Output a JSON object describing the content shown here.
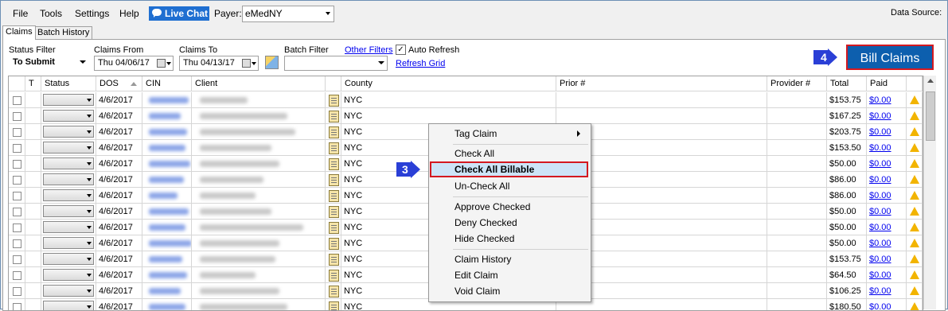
{
  "menu": {
    "file": "File",
    "tools": "Tools",
    "settings": "Settings",
    "help": "Help",
    "live_chat": "Live Chat",
    "payer_label": "Payer:",
    "payer_value": "eMedNY",
    "data_source_label": "Data Source:"
  },
  "tabs": {
    "claims": "Claims",
    "batch_history": "Batch History"
  },
  "filters": {
    "status_filter_label": "Status Filter",
    "status_filter_value": "To Submit",
    "claims_from_label": "Claims From",
    "claims_from_value": "Thu 04/06/17",
    "claims_to_label": "Claims To",
    "claims_to_value": "Thu 04/13/17",
    "batch_filter_label": "Batch Filter",
    "other_filters": "Other Filters",
    "auto_refresh": "Auto Refresh",
    "refresh_grid": "Refresh Grid"
  },
  "bill_claims": "Bill Claims",
  "callouts": {
    "step3": "3",
    "step4": "4"
  },
  "columns": {
    "t": "T",
    "status": "Status",
    "dos": "DOS",
    "cin": "CIN",
    "client": "Client",
    "county": "County",
    "prior": "Prior #",
    "provider": "Provider #",
    "total": "Total",
    "paid": "Paid"
  },
  "rows": [
    {
      "dos": "4/6/2017",
      "county": "NYC",
      "total": "$153.75",
      "paid": "$0.00"
    },
    {
      "dos": "4/6/2017",
      "county": "NYC",
      "total": "$167.25",
      "paid": "$0.00"
    },
    {
      "dos": "4/6/2017",
      "county": "NYC",
      "total": "$203.75",
      "paid": "$0.00"
    },
    {
      "dos": "4/6/2017",
      "county": "NYC",
      "total": "$153.50",
      "paid": "$0.00"
    },
    {
      "dos": "4/6/2017",
      "county": "NYC",
      "total": "$50.00",
      "paid": "$0.00"
    },
    {
      "dos": "4/6/2017",
      "county": "NYC",
      "total": "$86.00",
      "paid": "$0.00"
    },
    {
      "dos": "4/6/2017",
      "county": "NYC",
      "total": "$86.00",
      "paid": "$0.00"
    },
    {
      "dos": "4/6/2017",
      "county": "NYC",
      "total": "$50.00",
      "paid": "$0.00"
    },
    {
      "dos": "4/6/2017",
      "county": "NYC",
      "total": "$50.00",
      "paid": "$0.00"
    },
    {
      "dos": "4/6/2017",
      "county": "NYC",
      "total": "$50.00",
      "paid": "$0.00"
    },
    {
      "dos": "4/6/2017",
      "county": "NYC",
      "total": "$153.75",
      "paid": "$0.00"
    },
    {
      "dos": "4/6/2017",
      "county": "NYC",
      "total": "$64.50",
      "paid": "$0.00"
    },
    {
      "dos": "4/6/2017",
      "county": "NYC",
      "total": "$106.25",
      "paid": "$0.00"
    },
    {
      "dos": "4/6/2017",
      "county": "NYC",
      "total": "$180.50",
      "paid": "$0.00"
    }
  ],
  "context_menu": {
    "tag_claim": "Tag Claim",
    "check_all": "Check All",
    "check_all_billable": "Check All Billable",
    "uncheck_all": "Un-Check All",
    "approve_checked": "Approve Checked",
    "deny_checked": "Deny Checked",
    "hide_checked": "Hide Checked",
    "claim_history": "Claim History",
    "edit_claim": "Edit Claim",
    "void_claim": "Void Claim"
  },
  "colors": {
    "accent_blue": "#0d5fae",
    "highlight_red": "#d41920",
    "live_chat_blue": "#1f6fd1",
    "callout_blue": "#2a3fd6"
  }
}
